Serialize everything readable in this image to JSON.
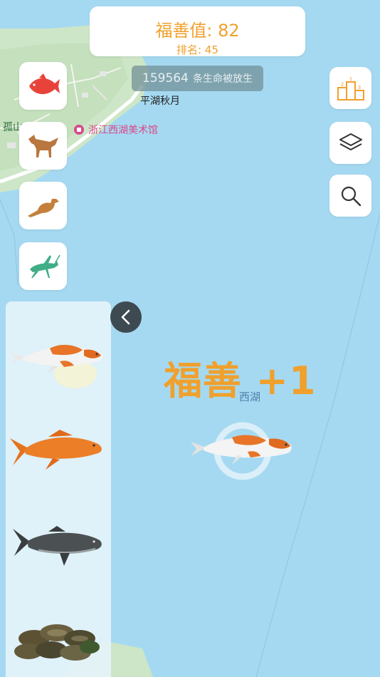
{
  "header": {
    "merit_label": "福善值: 82",
    "rank_label": "排名: 45"
  },
  "counter": {
    "number": "159564",
    "suffix": "条生命被放生"
  },
  "map": {
    "labels": {
      "pinghu": "平湖秋月",
      "gushan": "孤山",
      "museum": "浙江西湖美术馆"
    }
  },
  "categories": [
    {
      "name": "fish",
      "icon": "fish-icon",
      "color": "#e8433a"
    },
    {
      "name": "mammal",
      "icon": "fox-icon",
      "color": "#b9773f"
    },
    {
      "name": "bird",
      "icon": "bird-icon",
      "color": "#c4803b"
    },
    {
      "name": "insect",
      "icon": "grasshopper-icon",
      "color": "#3fae86"
    }
  ],
  "tools": [
    {
      "name": "ranking",
      "icon": "podium-icon"
    },
    {
      "name": "layers",
      "icon": "layers-icon"
    },
    {
      "name": "search",
      "icon": "search-icon"
    }
  ],
  "popup": {
    "text": "福善 +1",
    "location": "西湖"
  },
  "species_list": [
    {
      "name": "koi",
      "icon": "koi-fish-icon"
    },
    {
      "name": "goldfish",
      "icon": "goldfish-icon"
    },
    {
      "name": "carp",
      "icon": "carp-fish-icon"
    },
    {
      "name": "clams",
      "icon": "clams-icon"
    }
  ],
  "colors": {
    "accent": "#f0a02c",
    "water": "#a5d9f1",
    "land": "#cde6c7"
  }
}
